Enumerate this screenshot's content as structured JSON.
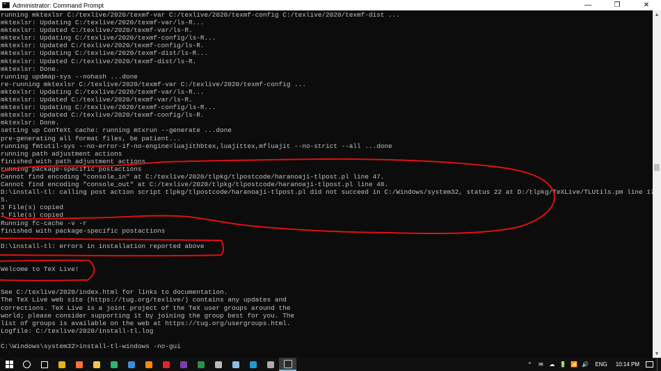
{
  "window": {
    "title": "Administrator: Command Prompt",
    "controls": {
      "minimize": "—",
      "maximize": "❐",
      "close": "✕"
    }
  },
  "console_lines": [
    "running mktexlsr C:/texlive/2020/texmf-var C:/texlive/2020/texmf-config C:/texlive/2020/texmf-dist ...",
    "mktexlsr: Updating C:/texlive/2020/texmf-var/ls-R...",
    "mktexlsr: Updated C:/texlive/2020/texmf-var/ls-R.",
    "mktexlsr: Updating C:/texlive/2020/texmf-config/ls-R...",
    "mktexlsr: Updated C:/texlive/2020/texmf-config/ls-R.",
    "mktexlsr: Updating C:/texlive/2020/texmf-dist/ls-R...",
    "mktexlsr: Updated C:/texlive/2020/texmf-dist/ls-R.",
    "mktexlsr: Done.",
    "running updmap-sys --nohash ...done",
    "re-running mktexlsr C:/texlive/2020/texmf-var C:/texlive/2020/texmf-config ...",
    "mktexlsr: Updating C:/texlive/2020/texmf-var/ls-R...",
    "mktexlsr: Updated C:/texlive/2020/texmf-var/ls-R.",
    "mktexlsr: Updating C:/texlive/2020/texmf-config/ls-R...",
    "mktexlsr: Updated C:/texlive/2020/texmf-config/ls-R.",
    "mktexlsr: Done.",
    "setting up ConTeXt cache: running mtxrun --generate ...done",
    "pre-generating all format files, be patient...",
    "running fmtutil-sys --no-error-if-no-engine=luajithbtex,luajittex,mfluajit --no-strict --all ...done",
    "running path adjustment actions",
    "finished with path adjustment actions",
    "running package-specific postactions",
    "Cannot find encoding \"console_in\" at C:/texlive/2020/tlpkg/tlpostcode/haranoaji-tlpost.pl line 47.",
    "Cannot find encoding \"console_out\" at C:/texlive/2020/tlpkg/tlpostcode/haranoaji-tlpost.pl line 48.",
    "D:\\install-tl: calling post action script tlpkg/tlpostcode/haranoaji-tlpost.pl did not succeed in C:/Windows/system32, status 22 at D:/tlpkg/TeXLive/TLUtils.pm line 177",
    "5.",
    "3 File(s) copied",
    "1 File(s) copied",
    "Running fc-cache -v -r",
    "finished with package-specific postactions",
    "",
    "D:\\install-tl: errors in installation reported above",
    "",
    "",
    "Welcome to TeX Live!",
    "",
    "",
    "See C:/texlive/2020/index.html for links to documentation.",
    "The TeX Live web site (https://tug.org/texlive/) contains any updates and",
    "corrections. TeX Live is a joint project of the TeX user groups around the",
    "world; please consider supporting it by joining the group best for you. The",
    "list of groups is available on the web at https://tug.org/usergroups.html.",
    "Logfile: C:/texlive/2020/install-tl.log",
    "",
    "C:\\Windows\\system32>install-tl-windows -no-gui"
  ],
  "annotation_color": "#e01010",
  "scrollbar": {
    "up_icon": "▲",
    "down_icon": "▼"
  },
  "taskbar": {
    "apps": [
      {
        "name": "chrome-icon",
        "color": "#e8b21a"
      },
      {
        "name": "firefox-icon",
        "color": "#ff7139"
      },
      {
        "name": "file-explorer-icon",
        "color": "#f2c94c"
      },
      {
        "name": "edge-icon",
        "color": "#2bb673"
      },
      {
        "name": "photos-icon",
        "color": "#3b8ed9"
      },
      {
        "name": "vlc-icon",
        "color": "#ff8800"
      },
      {
        "name": "opera-icon",
        "color": "#e0242c"
      },
      {
        "name": "visual-studio-icon",
        "color": "#7b3fb0"
      },
      {
        "name": "app-icon",
        "color": "#2c8f4a"
      },
      {
        "name": "settings-icon",
        "color": "#bbbbbb"
      },
      {
        "name": "notepad-icon",
        "color": "#8fbbe6"
      },
      {
        "name": "skype-icon",
        "color": "#1c9ad6"
      },
      {
        "name": "mail-icon",
        "color": "#aaaaaa"
      },
      {
        "name": "command-prompt-icon",
        "color": "#2a2a2a"
      }
    ],
    "tray": {
      "chevron": "^",
      "icons": [
        "✉",
        "☁",
        "🔋",
        "📶",
        "🔊"
      ],
      "language": "ENG",
      "time": "10:14 PM"
    }
  }
}
